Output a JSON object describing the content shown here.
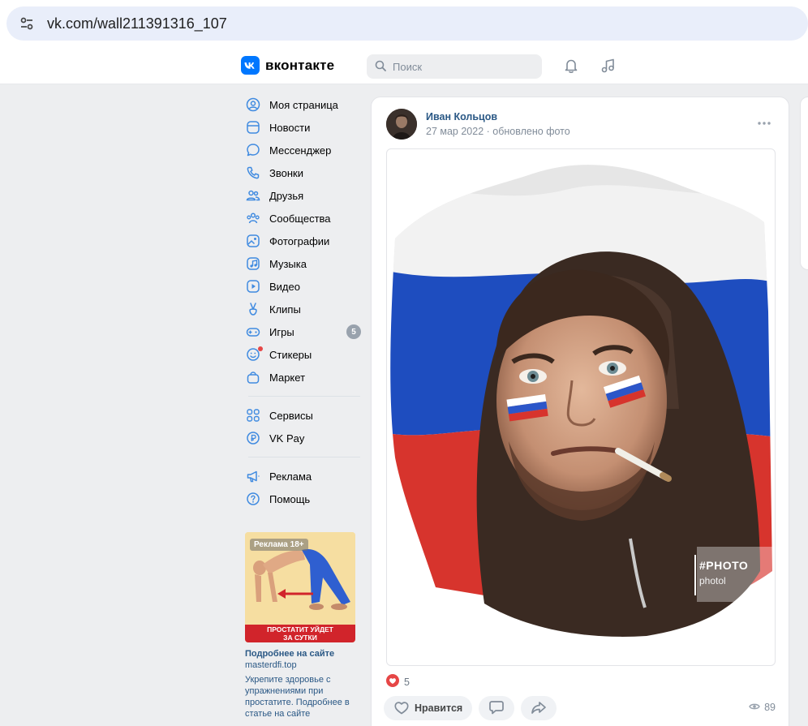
{
  "browser": {
    "url": "vk.com/wall211391316_107"
  },
  "header": {
    "logo_text": "вконтакте",
    "search_placeholder": "Поиск"
  },
  "sidebar": {
    "items": [
      {
        "label": "Моя страница",
        "icon": "profile-icon"
      },
      {
        "label": "Новости",
        "icon": "news-icon"
      },
      {
        "label": "Мессенджер",
        "icon": "chat-icon"
      },
      {
        "label": "Звонки",
        "icon": "phone-icon"
      },
      {
        "label": "Друзья",
        "icon": "friends-icon"
      },
      {
        "label": "Сообщества",
        "icon": "communities-icon"
      },
      {
        "label": "Фотографии",
        "icon": "photo-icon"
      },
      {
        "label": "Музыка",
        "icon": "music-icon"
      },
      {
        "label": "Видео",
        "icon": "video-icon"
      },
      {
        "label": "Клипы",
        "icon": "clips-icon"
      },
      {
        "label": "Игры",
        "icon": "games-icon",
        "badge": "5"
      },
      {
        "label": "Стикеры",
        "icon": "stickers-icon"
      },
      {
        "label": "Маркет",
        "icon": "market-icon"
      }
    ],
    "services": [
      {
        "label": "Сервисы",
        "icon": "services-icon"
      },
      {
        "label": "VK Pay",
        "icon": "vkpay-icon"
      }
    ],
    "misc": [
      {
        "label": "Реклама",
        "icon": "ads-icon"
      },
      {
        "label": "Помощь",
        "icon": "help-icon"
      }
    ]
  },
  "ad": {
    "badge": "Реклама 18+",
    "banner_line1": "ПРОСТАТИТ УЙДЕТ",
    "banner_line2": "ЗА СУТКИ",
    "title": "Подробнее на сайте",
    "domain": "masterdfi.top",
    "description": "Укрепите здоровье с упражнениями при простатите. Подробнее в статье на сайте"
  },
  "post": {
    "author": "Иван Кольцов",
    "date": "27 мар 2022",
    "separator": "·",
    "action": "обновлено фото",
    "watermark_line1": "#PHOTO",
    "watermark_line2": "photol",
    "likes": "5",
    "like_label": "Нравится",
    "views": "89"
  },
  "colors": {
    "vk_blue": "#0077ff",
    "link": "#2a5885",
    "like_red": "#e64646"
  }
}
